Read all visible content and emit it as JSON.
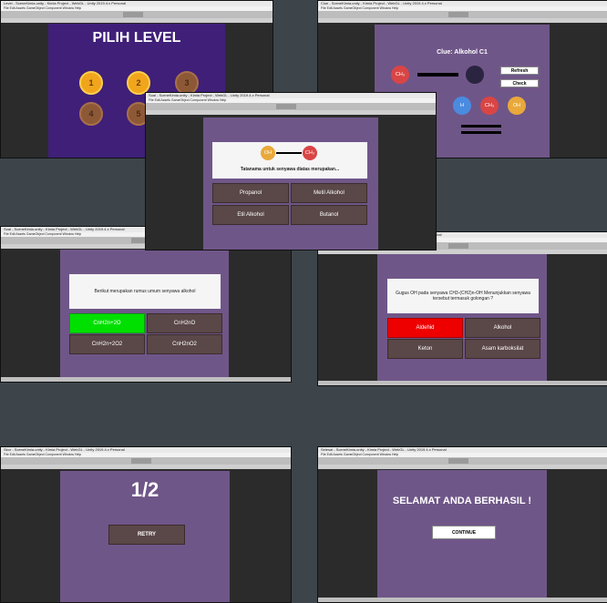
{
  "windows": {
    "w1": {
      "title": "Level - SceneKimia.unity - Kimia Project - WebGL - Unity 2019.4.x Personal",
      "menu": "File  Edit  Assets  GameObject  Component  Window  Help"
    },
    "w2": {
      "title": "Clue - SceneKimia.unity - Kimia Project - WebGL - Unity 2019.4.x Personal",
      "menu": "File  Edit  Assets  GameObject  Component  Window  Help"
    },
    "w3": {
      "title": "Soal - SceneKimia.unity - Kimia Project - WebGL - Unity 2019.4.x Personal",
      "menu": "File  Edit  Assets  GameObject  Component  Window  Help"
    },
    "w4": {
      "title": "Soal - SceneKimia.unity - Kimia Project - WebGL - Unity 2019.4.x Personal",
      "menu": "File  Edit  Assets  GameObject  Component  Window  Help"
    },
    "w5": {
      "title": "Soal - SceneKimia.unity - Kimia Project - WebGL - Unity 2019.4.x Personal",
      "menu": "File  Edit  Assets  GameObject  Component  Window  Help"
    },
    "w6": {
      "title": "Skor - SceneKimia.unity - Kimia Project - WebGL - Unity 2019.4.x Personal",
      "menu": "File  Edit  Assets  GameObject  Component  Window  Help"
    },
    "w7": {
      "title": "Selesai - SceneKimia.unity - Kimia Project - WebGL - Unity 2019.4.x Personal",
      "menu": "File  Edit  Assets  GameObject  Component  Window  Help"
    }
  },
  "level_screen": {
    "title": "PILIH LEVEL",
    "medals": [
      "1",
      "2",
      "3",
      "4",
      "5"
    ]
  },
  "clue_screen": {
    "title": "Clue: Alkohol C1",
    "ch3": "CH₃",
    "refresh": "Refresh",
    "check": "Check",
    "h": "H",
    "ch3b": "CH₃",
    "oh": "OH"
  },
  "naming_screen": {
    "oh": "OH",
    "ch3": "CH₃",
    "question": "Tatanama untuk senyawa diatas merupakan...",
    "options": [
      "Propanol",
      "Metil Alkohol",
      "Etil Alkohol",
      "Butanol"
    ]
  },
  "formula_screen": {
    "question": "Berikut merupakan rumus umum senyawa alkohol",
    "options": [
      "CnH2n+2O",
      "CnH2nO",
      "CnH2n+2O2",
      "CnH2nO2"
    ]
  },
  "group_screen": {
    "question": "Gugus OH pada senyawa CH3-(CH2)n-OH Menunjukkan senyawa tersebut termasuk golongan ?",
    "options": [
      "Aldehid",
      "Alkohol",
      "Keton",
      "Asam karboksilat"
    ]
  },
  "score_screen": {
    "score": "1/2",
    "retry": "RETRY"
  },
  "finish_screen": {
    "message": "SELAMAT ANDA BERHASIL !",
    "continue": "CONTINUE"
  },
  "colors": {
    "purple_bg": "#6f5688",
    "level_bg": "#3f1f78",
    "correct": "#00e000",
    "wrong": "#ee0000",
    "button": "#5a4747"
  }
}
